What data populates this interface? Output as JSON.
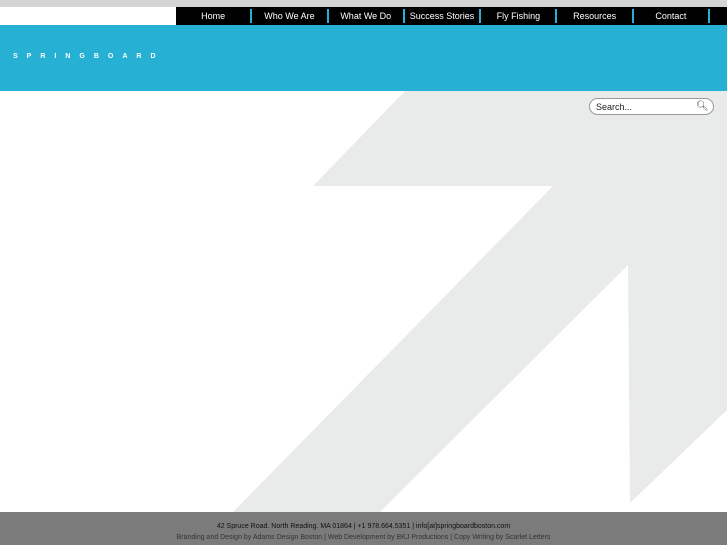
{
  "nav": {
    "items": [
      "Home",
      "Who We Are",
      "What We Do",
      "Success Stories",
      "Fly Fishing",
      "Resources",
      "Contact"
    ]
  },
  "brand": {
    "logo": "SPRINGBOARD",
    "colors": {
      "accent": "#25b0d4",
      "footer": "#7b7b7b",
      "arrow": "#e9eaea"
    }
  },
  "search": {
    "placeholder": "Search...",
    "icon": "search-icon"
  },
  "footer": {
    "address": "42 Spruce Road. North Reading. MA 01864 | +1 978.664.5351 | info[at]springboardboston.com",
    "credits": "Branding and Design by Adams Design Boston | Web Development by BKJ Productions | Copy Writing by Scarlet Letters"
  }
}
